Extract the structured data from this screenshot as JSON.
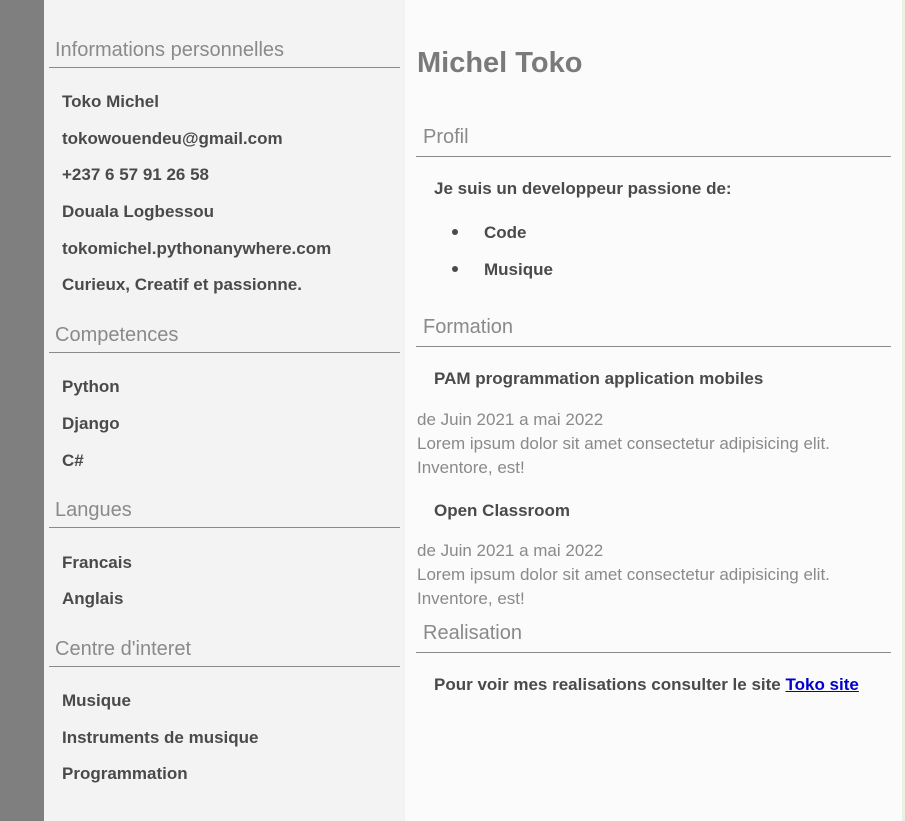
{
  "sidebar": {
    "personal": {
      "title": "Informations personnelles",
      "items": [
        "Toko Michel",
        "tokowouendeu@gmail.com",
        "+237 6 57 91 26 58",
        "Douala Logbessou",
        "tokomichel.pythonanywhere.com",
        "Curieux, Creatif et passionne."
      ]
    },
    "skills": {
      "title": "Competences",
      "items": [
        "Python",
        "Django",
        "C#"
      ]
    },
    "languages": {
      "title": "Langues",
      "items": [
        "Francais",
        "Anglais"
      ]
    },
    "interests": {
      "title": "Centre d'interet",
      "items": [
        "Musique",
        "Instruments de musique",
        "Programmation"
      ]
    }
  },
  "main": {
    "name": "Michel Toko",
    "profile": {
      "title": "Profil",
      "intro": "Je suis un developpeur passione de:",
      "passions": [
        "Code",
        "Musique"
      ]
    },
    "education": {
      "title": "Formation",
      "entries": [
        {
          "name": "PAM programmation application mobiles",
          "dates": "de Juin 2021 a mai 2022",
          "desc_line1": "Lorem ipsum dolor sit amet consectetur adipisicing elit.",
          "desc_line2": "Inventore, est!"
        },
        {
          "name": "Open Classroom",
          "dates": "de Juin 2021 a mai 2022",
          "desc_line1": "Lorem ipsum dolor sit amet consectetur adipisicing elit.",
          "desc_line2": "Inventore, est!"
        }
      ]
    },
    "projects": {
      "title": "Realisation",
      "text": "Pour voir mes realisations consulter le site",
      "link_label": "Toko site"
    }
  },
  "colors": {
    "left_strip": "#7f7f7f",
    "sidebar_bg": "#f3f3f3",
    "main_bg": "#fbfbfb",
    "heading_gray": "#8a8a8a",
    "text_dark": "#4a4a4a",
    "link_blue": "#0000cc"
  }
}
